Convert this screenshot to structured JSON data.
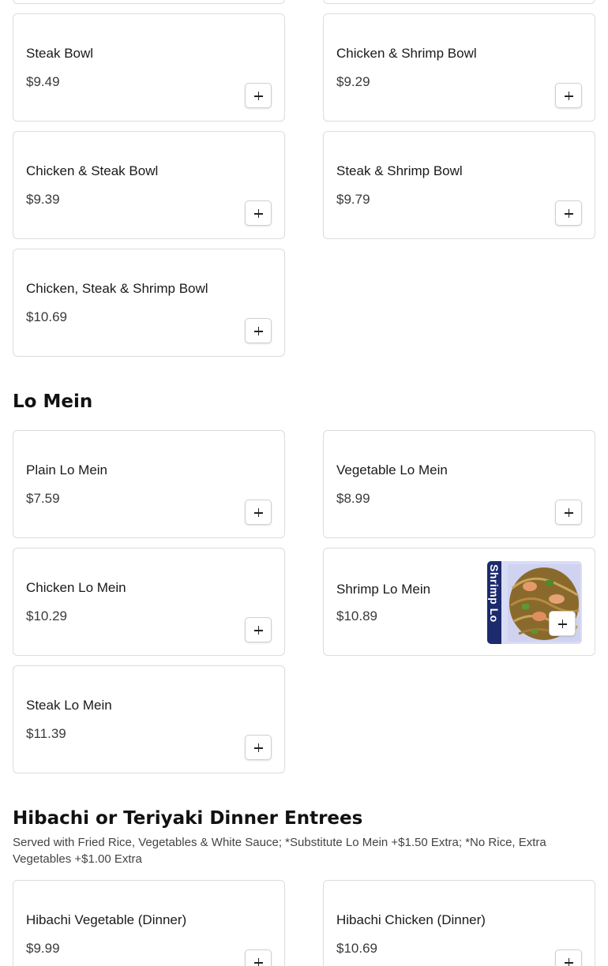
{
  "bowls": {
    "items": [
      {
        "name": "Steak Bowl",
        "price": "$9.49"
      },
      {
        "name": "Chicken & Shrimp Bowl",
        "price": "$9.29"
      },
      {
        "name": "Chicken & Steak Bowl",
        "price": "$9.39"
      },
      {
        "name": "Steak & Shrimp Bowl",
        "price": "$9.79"
      },
      {
        "name": "Chicken, Steak & Shrimp Bowl",
        "price": "$10.69"
      }
    ]
  },
  "lo_mein": {
    "title": "Lo Mein",
    "items": [
      {
        "name": "Plain Lo Mein",
        "price": "$7.59"
      },
      {
        "name": "Vegetable Lo Mein",
        "price": "$8.99"
      },
      {
        "name": "Chicken Lo Mein",
        "price": "$10.29"
      },
      {
        "name": "Shrimp Lo Mein",
        "price": "$10.89",
        "image_text": "Shrimp Lo Mein"
      },
      {
        "name": "Steak Lo Mein",
        "price": "$11.39"
      }
    ]
  },
  "hibachi": {
    "title": "Hibachi or Teriyaki Dinner Entrees",
    "description": "Served with Fried Rice, Vegetables & White Sauce; *Substitute Lo Mein +$1.50 Extra; *No Rice, Extra Vegetables +$1.00 Extra",
    "items": [
      {
        "name": "Hibachi Vegetable (Dinner)",
        "price": "$9.99"
      },
      {
        "name": "Hibachi Chicken (Dinner)",
        "price": "$10.69"
      }
    ]
  },
  "icons": {
    "add": "plus-icon"
  },
  "colors": {
    "border": "#dcdcdc",
    "text": "#1a1a1a",
    "thumb_band": "#1c2a6e"
  }
}
